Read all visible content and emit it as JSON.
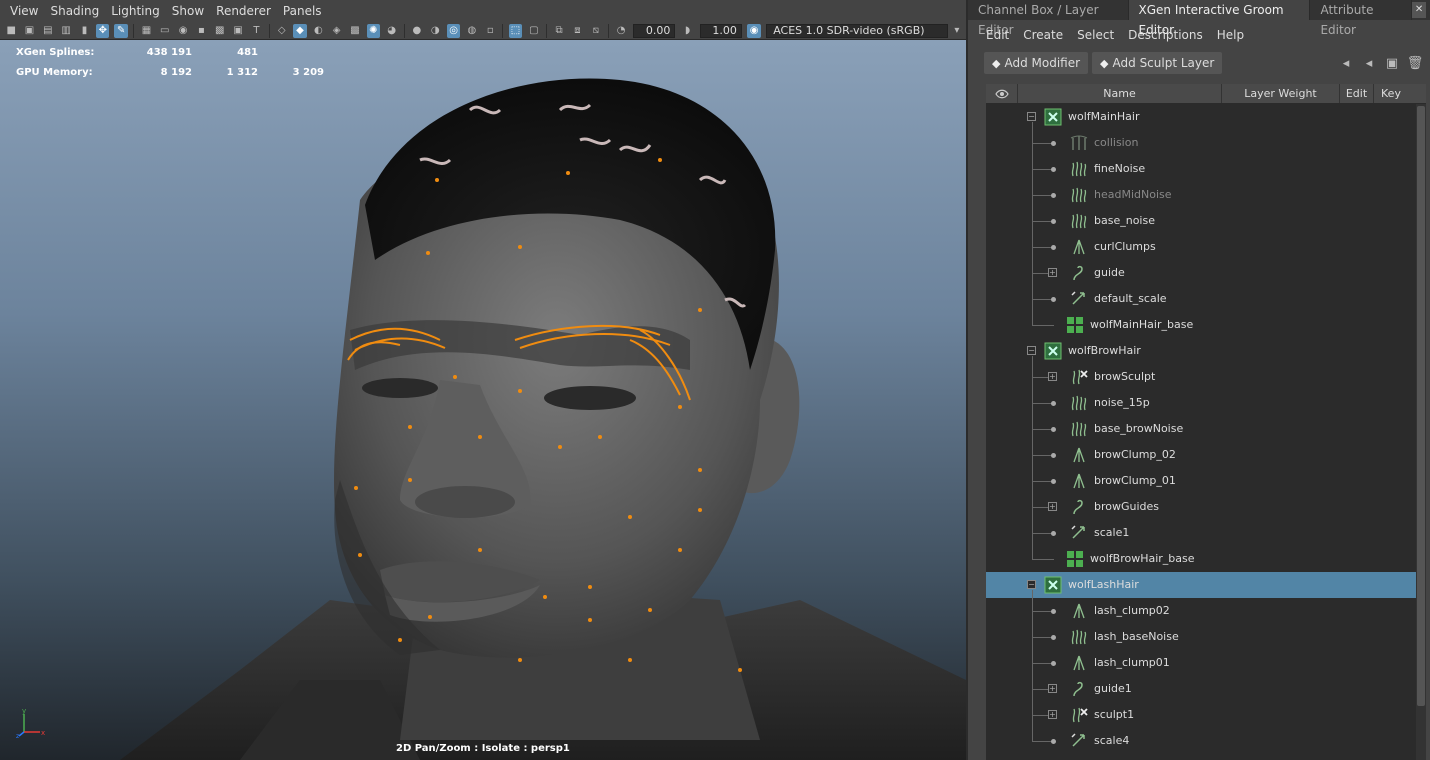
{
  "viewport": {
    "menu": [
      "View",
      "Shading",
      "Lighting",
      "Show",
      "Renderer",
      "Panels"
    ],
    "toolbar": {
      "exposure": "0.00",
      "gamma": "1.00",
      "color_space": "ACES 1.0 SDR-video (sRGB)"
    },
    "hud": [
      {
        "label": "XGen Splines:",
        "values": [
          "438 191",
          "481",
          ""
        ]
      },
      {
        "label": "GPU Memory:",
        "values": [
          "8 192",
          "1 312",
          "3 209"
        ]
      }
    ],
    "caption": "2D Pan/Zoom : Isolate : persp1",
    "axis": {
      "x": "x",
      "y": "y",
      "z": "z"
    }
  },
  "panel": {
    "tabs": [
      "Channel Box / Layer Editor",
      "XGen Interactive Groom Editor",
      "Attribute Editor"
    ],
    "active_tab": 1,
    "menu": [
      "Edit",
      "Create",
      "Select",
      "Descriptions",
      "Help"
    ],
    "buttons": {
      "add_modifier": "Add Modifier",
      "add_sculpt_layer": "Add Sculpt Layer"
    },
    "columns": {
      "name": "Name",
      "layer_weight": "Layer Weight",
      "edit": "Edit",
      "key": "Key"
    },
    "rows": [
      {
        "label": "wolfMainHair",
        "level": 0,
        "icon": "description-icon",
        "expander": "minus"
      },
      {
        "label": "collision",
        "level": 1,
        "icon": "collision-icon",
        "dim": true
      },
      {
        "label": "fineNoise",
        "level": 1,
        "icon": "noise-icon"
      },
      {
        "label": "headMidNoise",
        "level": 1,
        "icon": "noise-icon",
        "dim": true
      },
      {
        "label": "base_noise",
        "level": 1,
        "icon": "noise-icon"
      },
      {
        "label": "curlClumps",
        "level": 1,
        "icon": "clump-icon"
      },
      {
        "label": "guide",
        "level": 1,
        "icon": "guide-icon",
        "expander": "plus"
      },
      {
        "label": "default_scale",
        "level": 1,
        "icon": "scale-icon"
      },
      {
        "label": "wolfMainHair_base",
        "level": 1,
        "icon": "base-icon",
        "base": true
      },
      {
        "label": "wolfBrowHair",
        "level": 0,
        "icon": "description-icon",
        "expander": "minus"
      },
      {
        "label": "browSculpt",
        "level": 1,
        "icon": "sculpt-icon",
        "expander": "plus"
      },
      {
        "label": "noise_15p",
        "level": 1,
        "icon": "noise-icon"
      },
      {
        "label": "base_browNoise",
        "level": 1,
        "icon": "noise-icon"
      },
      {
        "label": "browClump_02",
        "level": 1,
        "icon": "clump-icon"
      },
      {
        "label": "browClump_01",
        "level": 1,
        "icon": "clump-icon"
      },
      {
        "label": "browGuides",
        "level": 1,
        "icon": "guide-icon",
        "expander": "plus"
      },
      {
        "label": "scale1",
        "level": 1,
        "icon": "scale-icon"
      },
      {
        "label": "wolfBrowHair_base",
        "level": 1,
        "icon": "base-icon",
        "base": true
      },
      {
        "label": "wolfLashHair",
        "level": 0,
        "icon": "description-icon",
        "expander": "minus",
        "selected": true
      },
      {
        "label": "lash_clump02",
        "level": 1,
        "icon": "clump-icon"
      },
      {
        "label": "lash_baseNoise",
        "level": 1,
        "icon": "noise-icon"
      },
      {
        "label": "lash_clump01",
        "level": 1,
        "icon": "clump-icon"
      },
      {
        "label": "guide1",
        "level": 1,
        "icon": "guide-icon",
        "expander": "plus"
      },
      {
        "label": "sculpt1",
        "level": 1,
        "icon": "sculpt-icon",
        "expander": "plus"
      },
      {
        "label": "scale4",
        "level": 1,
        "icon": "scale-icon"
      }
    ]
  }
}
